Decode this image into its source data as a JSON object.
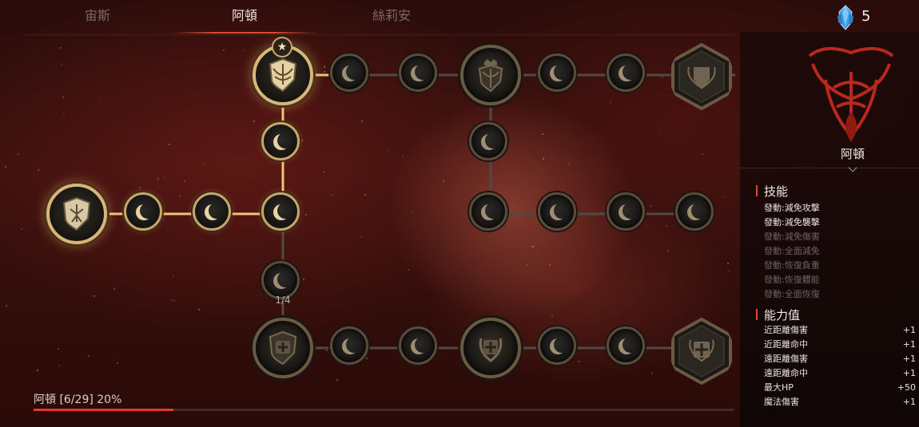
{
  "tabs": [
    {
      "label": "宙斯",
      "active": false
    },
    {
      "label": "阿頓",
      "active": true
    },
    {
      "label": "絲莉安",
      "active": false
    }
  ],
  "currency": {
    "icon": "blue-crystal-icon",
    "count": "5"
  },
  "tree": {
    "level_label": "1/4",
    "progress_label": "阿頓 [6/29] 20%",
    "progress_fraction": 0.2
  },
  "panel": {
    "name": "阿頓",
    "skills_title": "技能",
    "skills": [
      {
        "label": "發動:減免攻擊",
        "active": true
      },
      {
        "label": "發動:減免襲擊",
        "active": true
      },
      {
        "label": "發動:減免傷害",
        "active": false
      },
      {
        "label": "發動:全面減免",
        "active": false
      },
      {
        "label": "發動:恢復負重",
        "active": false
      },
      {
        "label": "發動:恢復體能",
        "active": false
      },
      {
        "label": "發動:全面恢復",
        "active": false
      }
    ],
    "stats_title": "能力值",
    "stats": [
      {
        "label": "近距離傷害",
        "value": "+1"
      },
      {
        "label": "近距離命中",
        "value": "+1"
      },
      {
        "label": "遠距離傷害",
        "value": "+1"
      },
      {
        "label": "遠距離命中",
        "value": "+1"
      },
      {
        "label": "最大HP",
        "value": "+50"
      },
      {
        "label": "魔法傷害",
        "value": "+1"
      }
    ]
  },
  "colors": {
    "accent": "#e03a2a",
    "gold": "#d8b679"
  }
}
